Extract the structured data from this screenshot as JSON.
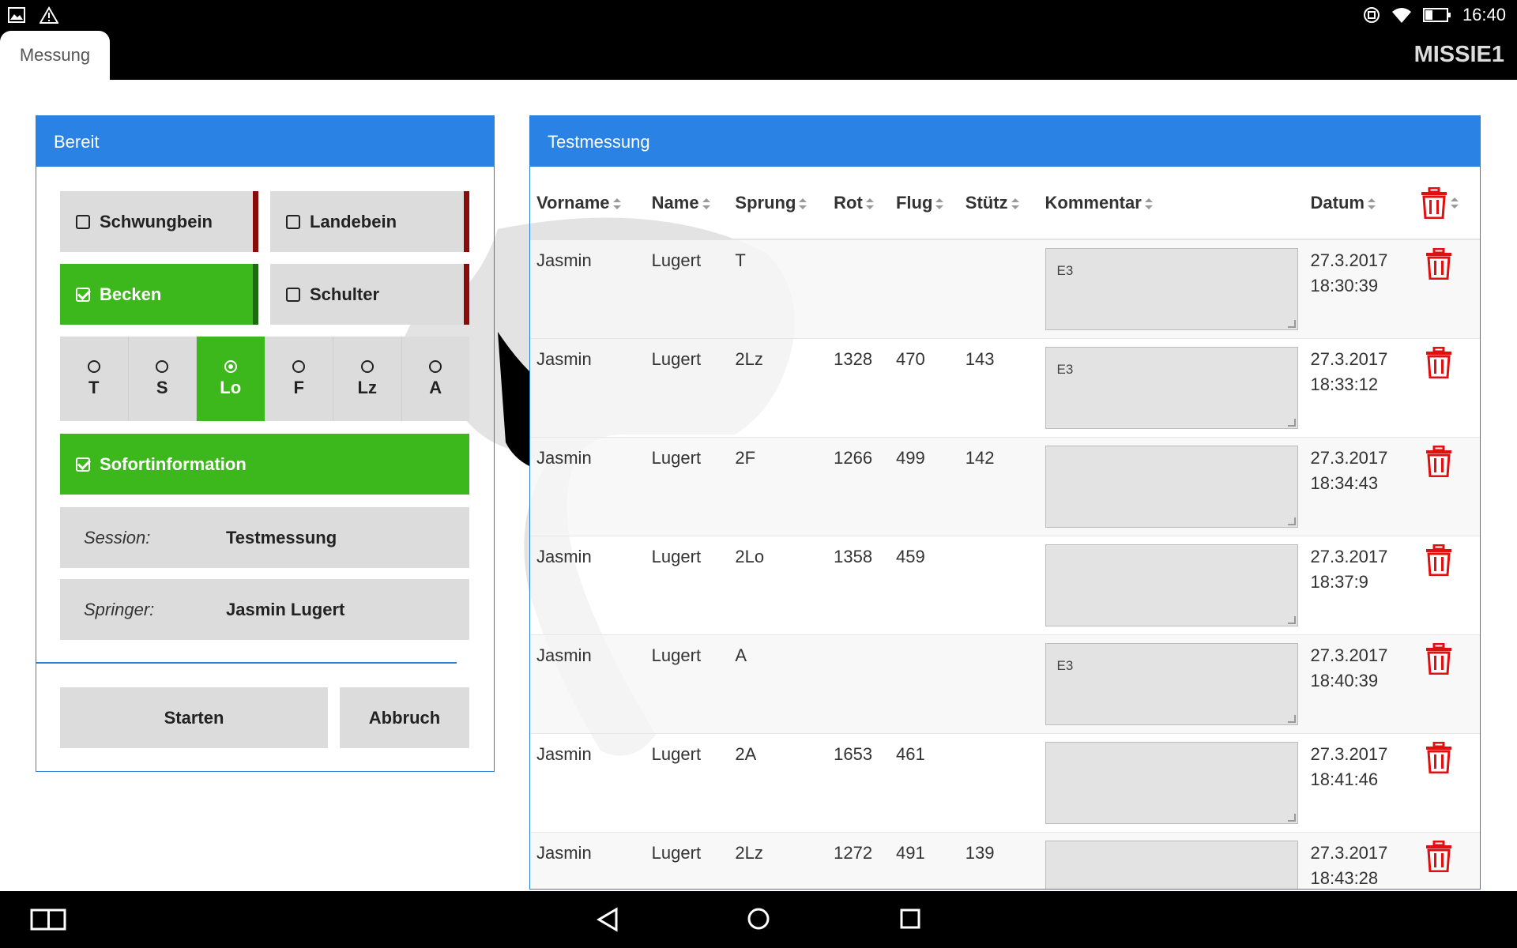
{
  "status": {
    "time": "16:40"
  },
  "header": {
    "tab_label": "Messung",
    "title": "MISSIE1"
  },
  "left_panel": {
    "title": "Bereit",
    "toggles": [
      {
        "label": "Schwungbein",
        "checked": false
      },
      {
        "label": "Landebein",
        "checked": false
      },
      {
        "label": "Becken",
        "checked": true
      },
      {
        "label": "Schulter",
        "checked": false
      }
    ],
    "jumps": [
      {
        "label": "T",
        "selected": false
      },
      {
        "label": "S",
        "selected": false
      },
      {
        "label": "Lo",
        "selected": true
      },
      {
        "label": "F",
        "selected": false
      },
      {
        "label": "Lz",
        "selected": false
      },
      {
        "label": "A",
        "selected": false
      }
    ],
    "sofortinfo": {
      "label": "Sofortinformation",
      "checked": true
    },
    "session": {
      "label": "Session:",
      "value": "Testmessung"
    },
    "springer": {
      "label": "Springer:",
      "value": "Jasmin Lugert"
    },
    "start_label": "Starten",
    "cancel_label": "Abbruch"
  },
  "right_panel": {
    "title": "Testmessung",
    "columns": [
      "Vorname",
      "Name",
      "Sprung",
      "Rot",
      "Flug",
      "Stütz",
      "Kommentar",
      "Datum"
    ],
    "rows": [
      {
        "vorname": "Jasmin",
        "name": "Lugert",
        "sprung": "T",
        "rot": "",
        "flug": "",
        "stuetz": "",
        "kommentar": "E3",
        "date": "27.3.2017",
        "time": "18:30:39"
      },
      {
        "vorname": "Jasmin",
        "name": "Lugert",
        "sprung": "2Lz",
        "rot": "1328",
        "flug": "470",
        "stuetz": "143",
        "kommentar": "E3",
        "date": "27.3.2017",
        "time": "18:33:12"
      },
      {
        "vorname": "Jasmin",
        "name": "Lugert",
        "sprung": "2F",
        "rot": "1266",
        "flug": "499",
        "stuetz": "142",
        "kommentar": "",
        "date": "27.3.2017",
        "time": "18:34:43"
      },
      {
        "vorname": "Jasmin",
        "name": "Lugert",
        "sprung": "2Lo",
        "rot": "1358",
        "flug": "459",
        "stuetz": "",
        "kommentar": "",
        "date": "27.3.2017",
        "time": "18:37:9"
      },
      {
        "vorname": "Jasmin",
        "name": "Lugert",
        "sprung": "A",
        "rot": "",
        "flug": "",
        "stuetz": "",
        "kommentar": "E3",
        "date": "27.3.2017",
        "time": "18:40:39"
      },
      {
        "vorname": "Jasmin",
        "name": "Lugert",
        "sprung": "2A",
        "rot": "1653",
        "flug": "461",
        "stuetz": "",
        "kommentar": "",
        "date": "27.3.2017",
        "time": "18:41:46"
      },
      {
        "vorname": "Jasmin",
        "name": "Lugert",
        "sprung": "2Lz",
        "rot": "1272",
        "flug": "491",
        "stuetz": "139",
        "kommentar": "",
        "date": "27.3.2017",
        "time": "18:43:28"
      }
    ]
  },
  "colors": {
    "accent_blue": "#2a82e4",
    "active_green": "#3db81c",
    "toggle_bar_red": "#8b0a0a",
    "trash_red": "#e01010"
  }
}
